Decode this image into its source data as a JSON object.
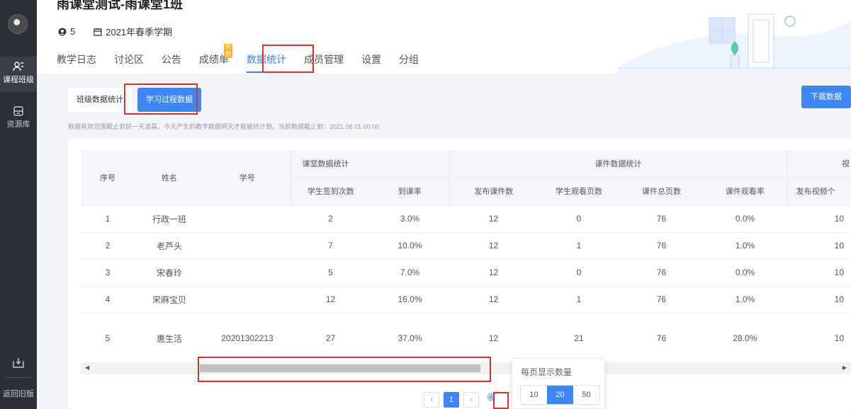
{
  "rail": {
    "nav_course": "课程班级",
    "nav_resources": "资源库",
    "back": "返回旧版"
  },
  "header": {
    "course_title": "雨课堂测试-雨课堂1班",
    "member_count": "5",
    "semester": "2021年春季学期",
    "tabs": [
      {
        "label": "教学日志"
      },
      {
        "label": "讨论区"
      },
      {
        "label": "公告"
      },
      {
        "label": "成绩单",
        "badge": "内测"
      },
      {
        "label": "数据统计"
      },
      {
        "label": "成员管理"
      },
      {
        "label": "设置"
      },
      {
        "label": "分组"
      }
    ]
  },
  "subnav": {
    "class_stats": "班级数据统计",
    "process_data": "学习过程数据",
    "download": "下载数据"
  },
  "note": "数据有效范围截止到前一天凌晨，今天产生的教学数据明天才能被统计到。当前数据截止到：2021.08.01 00:00",
  "table": {
    "headers": {
      "index": "序号",
      "name": "姓名",
      "student_id": "学号",
      "group_class": "课堂数据统计",
      "group_courseware": "课件数据统计",
      "group_next": "视",
      "checkins": "学生签到次数",
      "attendance": "到课率",
      "published": "发布课件数",
      "viewed_pages": "学生观看页数",
      "total_pages": "课件总页数",
      "view_rate": "课件观看率",
      "published_video": "发布视频个"
    },
    "rows": [
      {
        "index": "1",
        "name": "行政一班",
        "student_id": "",
        "checkins": "2",
        "attendance": "3.0%",
        "published": "12",
        "viewed_pages": "0",
        "total_pages": "76",
        "view_rate": "0.0%",
        "published_video": "10"
      },
      {
        "index": "2",
        "name": "老芦头",
        "student_id": "",
        "checkins": "7",
        "attendance": "10.0%",
        "published": "12",
        "viewed_pages": "1",
        "total_pages": "76",
        "view_rate": "1.0%",
        "published_video": "10"
      },
      {
        "index": "3",
        "name": "宋春玲",
        "student_id": "",
        "checkins": "5",
        "attendance": "7.0%",
        "published": "12",
        "viewed_pages": "0",
        "total_pages": "76",
        "view_rate": "0.0%",
        "published_video": "10"
      },
      {
        "index": "4",
        "name": "宋麻宝贝",
        "student_id": "",
        "checkins": "12",
        "attendance": "16.0%",
        "published": "12",
        "viewed_pages": "1",
        "total_pages": "76",
        "view_rate": "1.0%",
        "published_video": "10"
      },
      {
        "index": "5",
        "name": "惠生活",
        "student_id": "20201302213",
        "checkins": "27",
        "attendance": "37.0%",
        "published": "12",
        "viewed_pages": "21",
        "total_pages": "76",
        "view_rate": "28.0%",
        "published_video": "10"
      }
    ]
  },
  "page_size": {
    "title": "每页显示数量",
    "options": [
      "10",
      "20",
      "50"
    ],
    "selected": "20"
  },
  "pager": {
    "prev": "‹",
    "current": "1",
    "next": "›"
  },
  "colors": {
    "accent": "#3c86f5",
    "highlight": "#e0302a",
    "rail": "#2d2f36"
  }
}
